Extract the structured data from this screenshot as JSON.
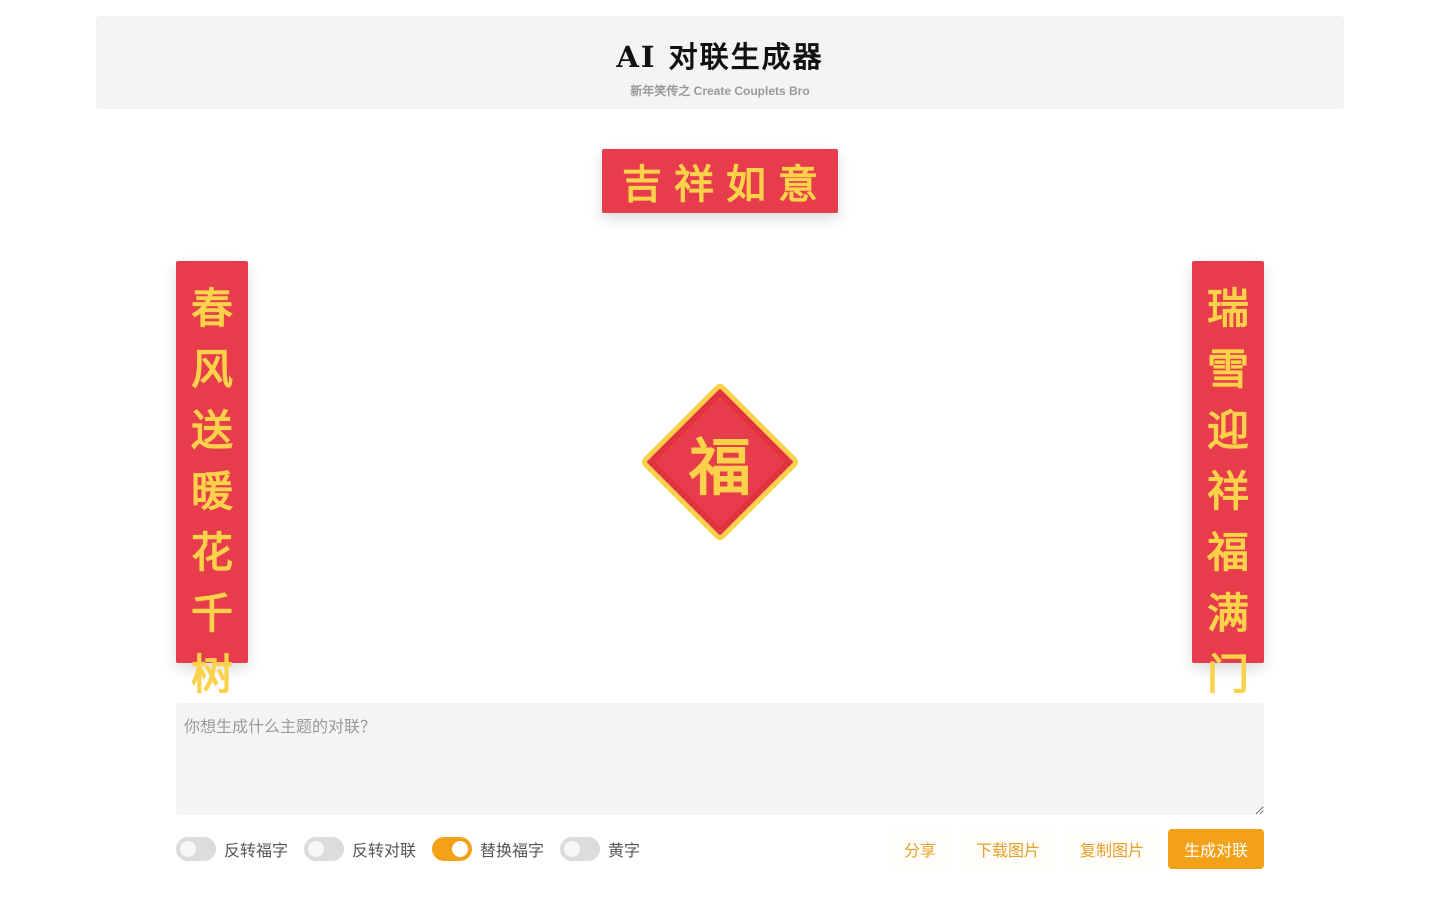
{
  "header": {
    "title": "AI 对联生成器",
    "subtitle": "新年笑传之 Create Couplets Bro"
  },
  "couplet": {
    "hengpi": "吉祥如意",
    "left": [
      "春",
      "风",
      "送",
      "暖",
      "花",
      "千",
      "树"
    ],
    "right": [
      "瑞",
      "雪",
      "迎",
      "祥",
      "福",
      "满",
      "门"
    ],
    "fu": "福"
  },
  "prompt": {
    "placeholder": "你想生成什么主题的对联？",
    "value": ""
  },
  "toggles": [
    {
      "label": "反转福字",
      "on": false
    },
    {
      "label": "反转对联",
      "on": false
    },
    {
      "label": "替换福字",
      "on": true
    },
    {
      "label": "黄字",
      "on": false
    }
  ],
  "actions": {
    "share": "分享",
    "download": "下载图片",
    "copy": "复制图片",
    "generate": "生成对联"
  },
  "colors": {
    "red": "#e73c4b",
    "gold": "#fbd24a",
    "accent": "#f4a11a"
  }
}
